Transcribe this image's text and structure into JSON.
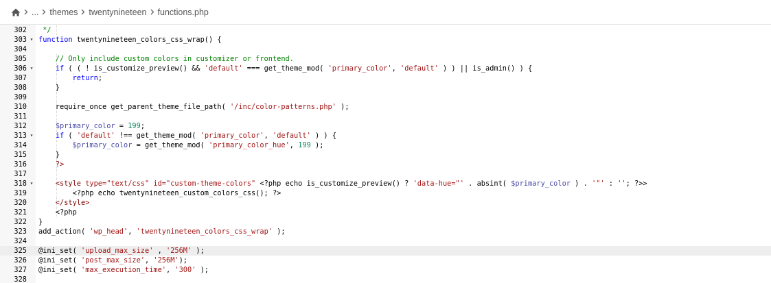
{
  "breadcrumb": {
    "ellipsis": "...",
    "items": [
      "themes",
      "twentynineteen",
      "functions.php"
    ]
  },
  "code": {
    "lines": [
      {
        "n": "302",
        "fold": false,
        "hl": false,
        "indent": 1,
        "tokens": [
          {
            "t": " */",
            "c": "cm"
          }
        ]
      },
      {
        "n": "303",
        "fold": true,
        "hl": false,
        "indent": 0,
        "tokens": [
          {
            "t": "function",
            "c": "kw"
          },
          {
            "t": " twentynineteen_colors_css_wrap() {",
            "c": ""
          }
        ]
      },
      {
        "n": "304",
        "fold": false,
        "hl": false,
        "indent": 0,
        "tokens": []
      },
      {
        "n": "305",
        "fold": false,
        "hl": false,
        "indent": 1,
        "tokens": [
          {
            "t": "    // Only include custom colors in customizer or frontend.",
            "c": "cm"
          }
        ]
      },
      {
        "n": "306",
        "fold": true,
        "hl": false,
        "indent": 1,
        "tokens": [
          {
            "t": "    ",
            "c": ""
          },
          {
            "t": "if",
            "c": "kw"
          },
          {
            "t": " ( ( ! is_customize_preview() && ",
            "c": ""
          },
          {
            "t": "'default'",
            "c": "str"
          },
          {
            "t": " === get_theme_mod( ",
            "c": ""
          },
          {
            "t": "'primary_color'",
            "c": "str"
          },
          {
            "t": ", ",
            "c": ""
          },
          {
            "t": "'default'",
            "c": "str"
          },
          {
            "t": " ) ) || is_admin() ) {",
            "c": ""
          }
        ]
      },
      {
        "n": "307",
        "fold": false,
        "hl": false,
        "indent": 2,
        "tokens": [
          {
            "t": "        ",
            "c": ""
          },
          {
            "t": "return",
            "c": "kw"
          },
          {
            "t": ";",
            "c": ""
          }
        ]
      },
      {
        "n": "308",
        "fold": false,
        "hl": false,
        "indent": 1,
        "tokens": [
          {
            "t": "    }",
            "c": ""
          }
        ]
      },
      {
        "n": "309",
        "fold": false,
        "hl": false,
        "indent": 1,
        "tokens": []
      },
      {
        "n": "310",
        "fold": false,
        "hl": false,
        "indent": 1,
        "tokens": [
          {
            "t": "    require_once get_parent_theme_file_path( ",
            "c": ""
          },
          {
            "t": "'/inc/color-patterns.php'",
            "c": "str"
          },
          {
            "t": " );",
            "c": ""
          }
        ]
      },
      {
        "n": "311",
        "fold": false,
        "hl": false,
        "indent": 1,
        "tokens": []
      },
      {
        "n": "312",
        "fold": false,
        "hl": false,
        "indent": 1,
        "tokens": [
          {
            "t": "    ",
            "c": ""
          },
          {
            "t": "$primary_color",
            "c": "var"
          },
          {
            "t": " = ",
            "c": ""
          },
          {
            "t": "199",
            "c": "num"
          },
          {
            "t": ";",
            "c": ""
          }
        ]
      },
      {
        "n": "313",
        "fold": true,
        "hl": false,
        "indent": 1,
        "tokens": [
          {
            "t": "    ",
            "c": ""
          },
          {
            "t": "if",
            "c": "kw"
          },
          {
            "t": " ( ",
            "c": ""
          },
          {
            "t": "'default'",
            "c": "str"
          },
          {
            "t": " !== get_theme_mod( ",
            "c": ""
          },
          {
            "t": "'primary_color'",
            "c": "str"
          },
          {
            "t": ", ",
            "c": ""
          },
          {
            "t": "'default'",
            "c": "str"
          },
          {
            "t": " ) ) {",
            "c": ""
          }
        ]
      },
      {
        "n": "314",
        "fold": false,
        "hl": false,
        "indent": 2,
        "tokens": [
          {
            "t": "        ",
            "c": ""
          },
          {
            "t": "$primary_color",
            "c": "var"
          },
          {
            "t": " = get_theme_mod( ",
            "c": ""
          },
          {
            "t": "'primary_color_hue'",
            "c": "str"
          },
          {
            "t": ", ",
            "c": ""
          },
          {
            "t": "199",
            "c": "num"
          },
          {
            "t": " );",
            "c": ""
          }
        ]
      },
      {
        "n": "315",
        "fold": false,
        "hl": false,
        "indent": 1,
        "tokens": [
          {
            "t": "    }",
            "c": ""
          }
        ]
      },
      {
        "n": "316",
        "fold": false,
        "hl": false,
        "indent": 1,
        "tokens": [
          {
            "t": "    ?>",
            "c": "tag"
          }
        ]
      },
      {
        "n": "317",
        "fold": false,
        "hl": false,
        "indent": 1,
        "tokens": []
      },
      {
        "n": "318",
        "fold": true,
        "hl": false,
        "indent": 1,
        "tokens": [
          {
            "t": "    <style ",
            "c": "tag"
          },
          {
            "t": "type=\"text/css\" id=\"custom-theme-colors\"",
            "c": "str"
          },
          {
            "t": " <?php echo is_customize_preview() ? ",
            "c": ""
          },
          {
            "t": "'data-hue=\"'",
            "c": "str"
          },
          {
            "t": " . absint( ",
            "c": ""
          },
          {
            "t": "$primary_color",
            "c": "var"
          },
          {
            "t": " ) . ",
            "c": ""
          },
          {
            "t": "'\"'",
            "c": "str"
          },
          {
            "t": " : ",
            "c": ""
          },
          {
            "t": "''",
            "c": "str"
          },
          {
            "t": "; ?>>",
            "c": ""
          }
        ]
      },
      {
        "n": "319",
        "fold": false,
        "hl": false,
        "indent": 2,
        "tokens": [
          {
            "t": "        <?php echo twentynineteen_custom_colors_css(); ?>",
            "c": ""
          }
        ]
      },
      {
        "n": "320",
        "fold": false,
        "hl": false,
        "indent": 1,
        "tokens": [
          {
            "t": "    </style>",
            "c": "tag"
          }
        ]
      },
      {
        "n": "321",
        "fold": false,
        "hl": false,
        "indent": 1,
        "tokens": [
          {
            "t": "    <?php",
            "c": ""
          }
        ]
      },
      {
        "n": "322",
        "fold": false,
        "hl": false,
        "indent": 0,
        "tokens": [
          {
            "t": "}",
            "c": ""
          }
        ]
      },
      {
        "n": "323",
        "fold": false,
        "hl": false,
        "indent": 0,
        "tokens": [
          {
            "t": "add_action( ",
            "c": ""
          },
          {
            "t": "'wp_head'",
            "c": "str"
          },
          {
            "t": ", ",
            "c": ""
          },
          {
            "t": "'twentynineteen_colors_css_wrap'",
            "c": "str"
          },
          {
            "t": " );",
            "c": ""
          }
        ]
      },
      {
        "n": "324",
        "fold": false,
        "hl": false,
        "indent": 0,
        "tokens": []
      },
      {
        "n": "325",
        "fold": false,
        "hl": true,
        "indent": 0,
        "tokens": [
          {
            "t": "@ini_set( ",
            "c": ""
          },
          {
            "t": "'upload_max_size'",
            "c": "str"
          },
          {
            "t": " , ",
            "c": ""
          },
          {
            "t": "'256M'",
            "c": "str"
          },
          {
            "t": " );",
            "c": ""
          }
        ]
      },
      {
        "n": "326",
        "fold": false,
        "hl": false,
        "indent": 0,
        "tokens": [
          {
            "t": "@ini_set( ",
            "c": ""
          },
          {
            "t": "'post_max_size'",
            "c": "str"
          },
          {
            "t": ", ",
            "c": ""
          },
          {
            "t": "'256M'",
            "c": "str"
          },
          {
            "t": ");",
            "c": ""
          }
        ]
      },
      {
        "n": "327",
        "fold": false,
        "hl": false,
        "indent": 0,
        "tokens": [
          {
            "t": "@ini_set( ",
            "c": ""
          },
          {
            "t": "'max_execution_time'",
            "c": "str"
          },
          {
            "t": ", ",
            "c": ""
          },
          {
            "t": "'300'",
            "c": "str"
          },
          {
            "t": " );",
            "c": ""
          }
        ]
      },
      {
        "n": "328",
        "fold": false,
        "hl": false,
        "indent": 0,
        "tokens": []
      }
    ]
  }
}
